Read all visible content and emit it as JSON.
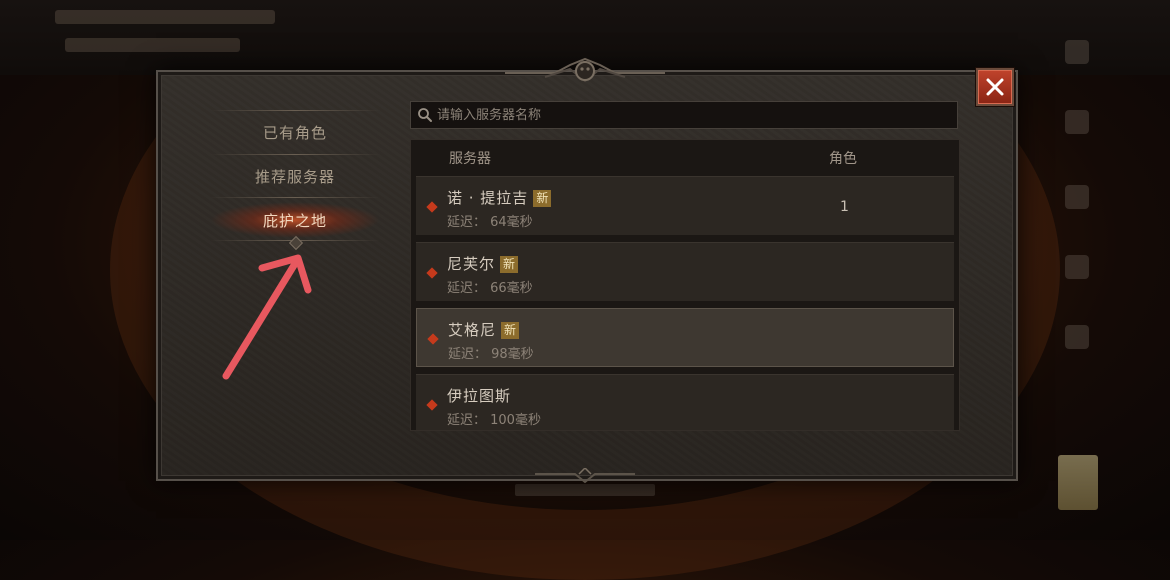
{
  "nav": {
    "items": [
      {
        "label": "已有角色",
        "active": false
      },
      {
        "label": "推荐服务器",
        "active": false
      },
      {
        "label": "庇护之地",
        "active": true
      }
    ]
  },
  "search": {
    "placeholder": "请输入服务器名称",
    "value": ""
  },
  "table": {
    "headers": {
      "server": "服务器",
      "roles": "角色"
    },
    "rows": [
      {
        "name": "诺 · 提拉吉",
        "badge": "新",
        "latency": "延迟： 64毫秒",
        "roles": "1",
        "selected": false
      },
      {
        "name": "尼芙尔",
        "badge": "新",
        "latency": "延迟： 66毫秒",
        "roles": "",
        "selected": false
      },
      {
        "name": "艾格尼",
        "badge": "新",
        "latency": "延迟： 98毫秒",
        "roles": "",
        "selected": true
      },
      {
        "name": "伊拉图斯",
        "badge": "",
        "latency": "延迟： 100毫秒",
        "roles": "",
        "selected": false
      }
    ]
  },
  "colors": {
    "accent": "#c53a1c",
    "annotation_arrow": "#e8585f",
    "badge": "#8c6c2c"
  },
  "icons": {
    "close": "close-icon",
    "search": "search-icon"
  }
}
